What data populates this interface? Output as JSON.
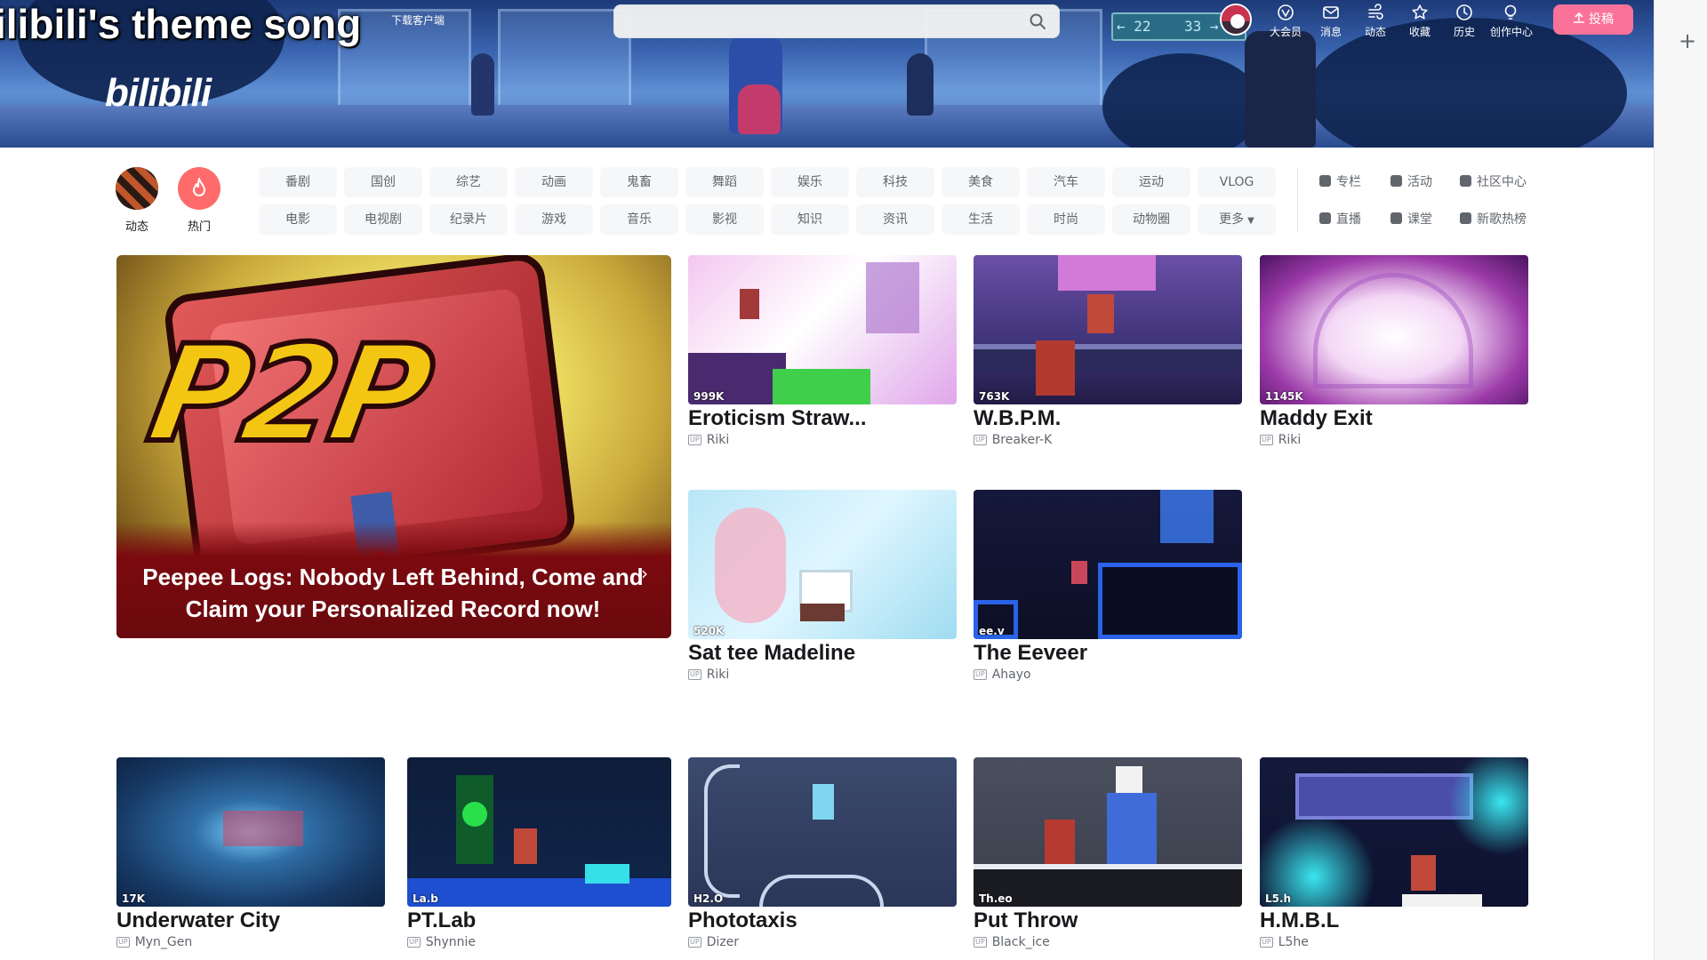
{
  "banner": {
    "title": "ilibili's theme song",
    "download": "下载客户端",
    "logo": "bilibili",
    "sign_left": "22",
    "sign_right": "33"
  },
  "search": {
    "value": "",
    "placeholder": ""
  },
  "header_icons": [
    {
      "name": "vip",
      "label": "大会员"
    },
    {
      "name": "messages",
      "label": "消息"
    },
    {
      "name": "dynamics",
      "label": "动态"
    },
    {
      "name": "favorites",
      "label": "收藏"
    },
    {
      "name": "history",
      "label": "历史"
    },
    {
      "name": "creator-center",
      "label": "创作中心"
    }
  ],
  "upload_label": "投稿",
  "nav": {
    "dynamic_label": "动态",
    "hot_label": "热门",
    "row1": [
      "番剧",
      "国创",
      "综艺",
      "动画",
      "鬼畜",
      "舞蹈",
      "娱乐",
      "科技",
      "美食",
      "汽车",
      "运动",
      "VLOG"
    ],
    "row2": [
      "电影",
      "电视剧",
      "纪录片",
      "游戏",
      "音乐",
      "影视",
      "知识",
      "资讯",
      "生活",
      "时尚",
      "动物圈",
      "更多"
    ],
    "extras": [
      "专栏",
      "活动",
      "社区中心",
      "直播",
      "课堂",
      "新歌热榜"
    ]
  },
  "hero": {
    "title": "Peepee Logs: Nobody Left Behind, Come and Claim your Personalized Record now!"
  },
  "up_badge": "UP",
  "videos": [
    {
      "title": "Eroticism Straw...",
      "author": "Riki",
      "stat": "999K"
    },
    {
      "title": "W.B.P.M.",
      "author": "Breaker-K",
      "stat": "763K"
    },
    {
      "title": "Maddy Exit",
      "author": "Riki",
      "stat": "1145K"
    },
    {
      "title": "Sat tee Madeline",
      "author": "Riki",
      "stat": "520K"
    },
    {
      "title": "The Eeveer",
      "author": "Ahayo",
      "stat": "ee.v"
    },
    {
      "title": "Underwater City",
      "author": "Myn_Gen",
      "stat": "17K"
    },
    {
      "title": "PT.Lab",
      "author": "Shynnie",
      "stat": "La.b"
    },
    {
      "title": "Phototaxis",
      "author": "Dizer",
      "stat": "H2.O"
    },
    {
      "title": "Put Throw",
      "author": "Black_ice",
      "stat": "Th.eo"
    },
    {
      "title": "H.M.B.L",
      "author": "L5he",
      "stat": "L5.h"
    }
  ]
}
